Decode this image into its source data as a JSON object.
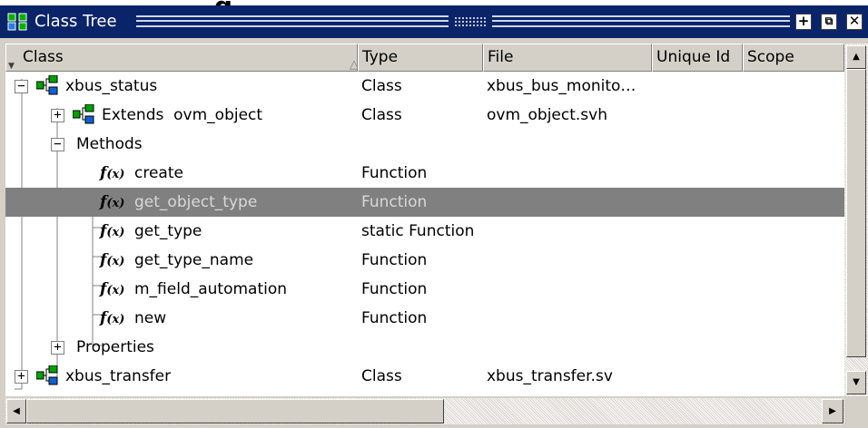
{
  "window": {
    "title": "Class Tree",
    "icon": "class-tree-icon",
    "buttons": [
      {
        "name": "maximize-button",
        "icon": "plus-icon",
        "glyph": "+"
      },
      {
        "name": "undock-button",
        "icon": "undock-icon",
        "glyph": "⧉"
      },
      {
        "name": "close-button",
        "icon": "close-icon",
        "glyph": "✕"
      }
    ]
  },
  "columns": [
    {
      "label": "Class",
      "sorted": "ascending"
    },
    {
      "label": "Type"
    },
    {
      "label": "File"
    },
    {
      "label": "Unique Id"
    },
    {
      "label": "Scope"
    }
  ],
  "rows": [
    {
      "label": "xbus_status",
      "type": "Class",
      "file": "xbus_bus_monito…",
      "icon": "class-icon",
      "expander": "−"
    },
    {
      "label": "Extends  ovm_object",
      "type": "Class",
      "file": "ovm_object.svh",
      "icon": "class-icon",
      "expander": "+"
    },
    {
      "label": "Methods",
      "type": "",
      "file": "",
      "icon": "",
      "expander": "−"
    },
    {
      "label": "create",
      "type": "Function",
      "file": "",
      "icon": "function-icon"
    },
    {
      "label": "get_object_type",
      "type": "Function",
      "file": "",
      "icon": "function-icon",
      "selected": true
    },
    {
      "label": "get_type",
      "type": "static Function",
      "file": "",
      "icon": "function-icon"
    },
    {
      "label": "get_type_name",
      "type": "Function",
      "file": "",
      "icon": "function-icon"
    },
    {
      "label": "m_field_automation",
      "type": "Function",
      "file": "",
      "icon": "function-icon"
    },
    {
      "label": "new",
      "type": "Function",
      "file": "",
      "icon": "function-icon"
    },
    {
      "label": "Properties",
      "type": "",
      "file": "",
      "icon": "",
      "expander": "+"
    },
    {
      "label": "xbus_transfer",
      "type": "Class",
      "file": "xbus_transfer.sv",
      "icon": "class-icon",
      "expander": "+"
    }
  ],
  "colors": {
    "titlebar": "#0a246a",
    "selection": "#808080",
    "chrome": "#d4d0c8",
    "class_icon_green": "#00a000",
    "class_icon_blue": "#1060d0"
  }
}
